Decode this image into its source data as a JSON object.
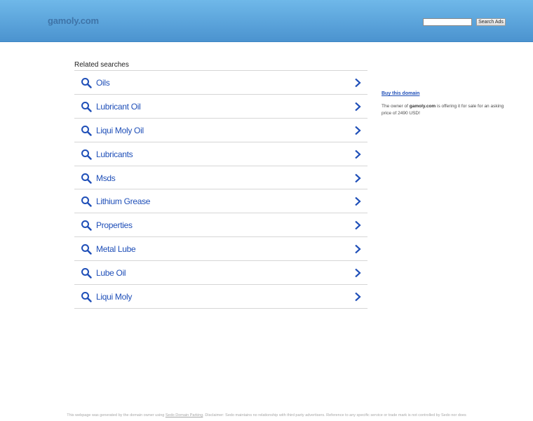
{
  "header": {
    "domain": "gamoly.com",
    "search_placeholder": "",
    "search_button": "Search Ads"
  },
  "related": {
    "heading": "Related searches",
    "items": [
      {
        "label": "Oils"
      },
      {
        "label": "Lubricant Oil"
      },
      {
        "label": "Liqui Moly Oil"
      },
      {
        "label": "Lubricants"
      },
      {
        "label": "Msds"
      },
      {
        "label": "Lithium Grease"
      },
      {
        "label": "Properties"
      },
      {
        "label": "Metal Lube"
      },
      {
        "label": "Lube Oil"
      },
      {
        "label": "Liqui Moly"
      }
    ]
  },
  "sidebar": {
    "buy_link": "Buy this domain",
    "sale_prefix": "The owner of ",
    "sale_domain": "gamoly.com",
    "sale_suffix": " is offering it for sale for an asking price of 2490 USD!"
  },
  "footer": {
    "prefix": "This webpage was generated by the domain owner using ",
    "link": "Sedo Domain Parking",
    "suffix": ". Disclaimer: Sedo maintains no relationship with third party advertisers. Reference to any specific service or trade mark is not controlled by Sedo nor does"
  },
  "colors": {
    "header_top": "#6fb8e9",
    "header_bottom": "#4b93cf",
    "link": "#1f4fb8",
    "divider": "#d6d6d6"
  },
  "icons": {
    "item_icon": "search-icon",
    "item_arrow": "chevron-right-icon"
  }
}
